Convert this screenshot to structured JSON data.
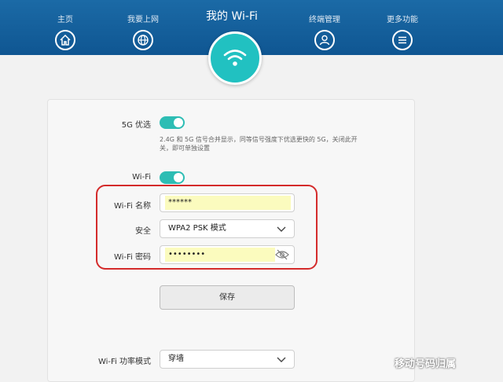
{
  "header": {
    "title": "我的 Wi-Fi",
    "nav": [
      {
        "label": "主页",
        "icon": "home-icon"
      },
      {
        "label": "我要上网",
        "icon": "globe-icon"
      },
      {
        "label": "终端管理",
        "icon": "user-icon"
      },
      {
        "label": "更多功能",
        "icon": "menu-icon"
      }
    ],
    "center_icon": "wifi-icon"
  },
  "settings": {
    "band_priority_label": "5G 优选",
    "band_priority_on": true,
    "band_priority_hint": "2.4G 和 5G 信号合并显示，同等信号强度下优选更快的 5G，关闭此开关，即可单独设置",
    "wifi_label": "Wi-Fi",
    "wifi_on": true,
    "ssid_label": "Wi-Fi 名称",
    "ssid_value": "******",
    "security_label": "安全",
    "security_value": "WPA2 PSK 模式",
    "password_label": "Wi-Fi 密码",
    "password_value": "••••••••",
    "save_label": "保存",
    "power_mode_label": "Wi-Fi 功率模式",
    "power_mode_value": "穿墙"
  },
  "watermark": "移动号码归属",
  "colors": {
    "header": "#1561a0",
    "accent": "#21c1c1",
    "toggle_on": "#2dbdb4",
    "highlight": "#d42b2b",
    "autofill": "#fbfbbe"
  }
}
